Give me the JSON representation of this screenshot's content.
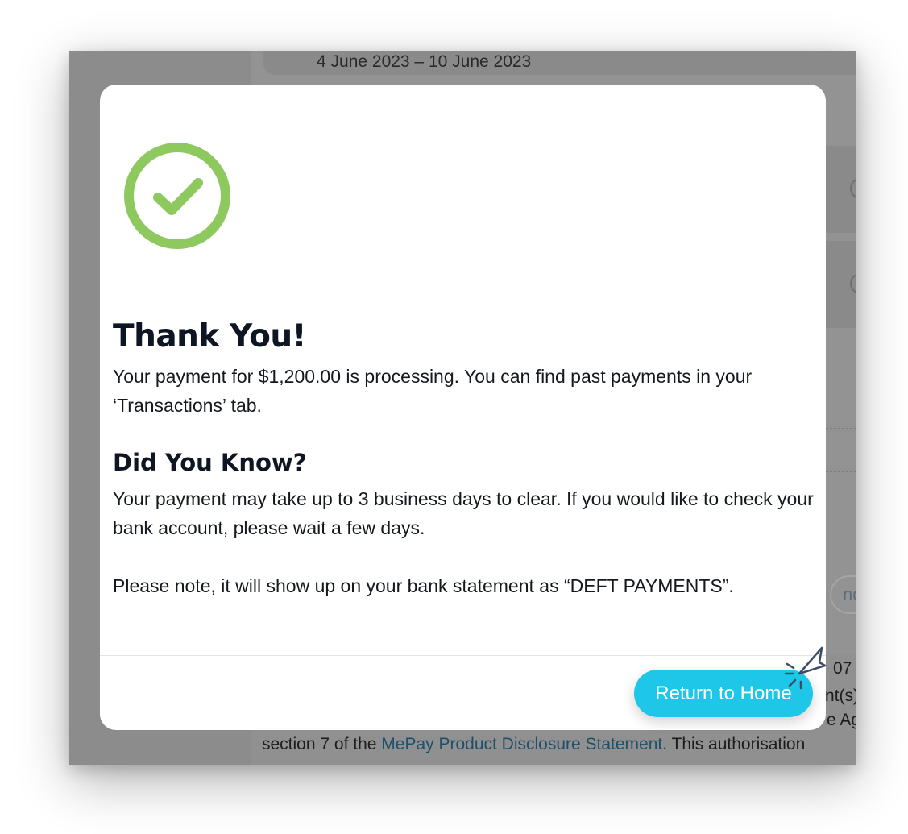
{
  "background": {
    "date_range": "4 June 2023 – 10 June 2023",
    "cancel_fragment": "ncel",
    "footer_fragments": [
      "07",
      "nt(s)",
      "e Ag"
    ],
    "legal": {
      "prefix": "section 7 of the ",
      "link": "MePay Product Disclosure Statement",
      "suffix": ". This authorisation"
    }
  },
  "modal": {
    "icon": "check-circle-icon",
    "title": "Thank You!",
    "message": "Your payment for $1,200.00 is processing. You can find past payments in your ‘Transactions’ tab.",
    "subtitle": "Did You Know?",
    "info": "Your payment may take up to 3 business days to clear. If you would like to check your bank account, please wait a few days.",
    "note": "Please note, it will show up on your bank statement as “DEFT PAYMENTS”.",
    "return_label": "Return to Home"
  },
  "colors": {
    "accent": "#1ec6e8",
    "success": "#8ec95f",
    "link": "#1f4f6b"
  }
}
